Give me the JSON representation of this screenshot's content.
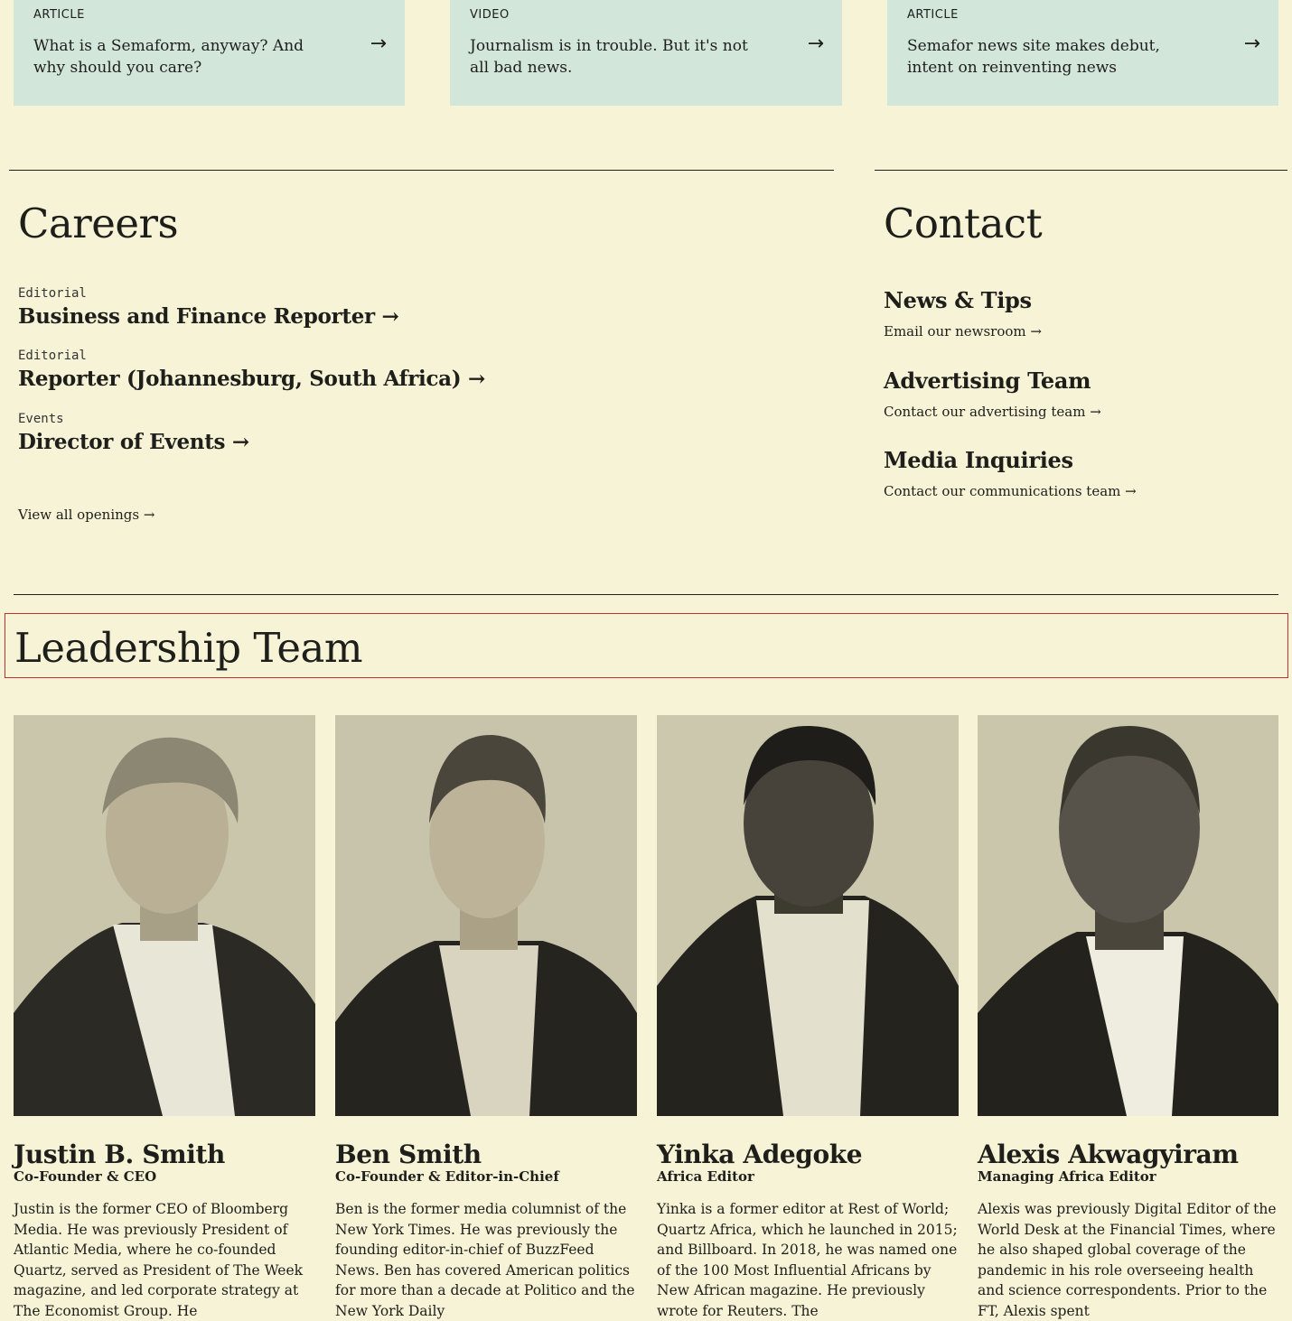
{
  "cards": [
    {
      "kind": "ARTICLE",
      "title": "What is a Semaform, anyway? And why should you care?",
      "arrow": "→"
    },
    {
      "kind": "VIDEO",
      "title": "Journalism is in trouble. But it's not all bad news.",
      "arrow": "→"
    },
    {
      "kind": "ARTICLE",
      "title": "Semafor news site makes debut, intent on reinventing news",
      "arrow": "→"
    }
  ],
  "careers": {
    "title": "Careers",
    "jobs": [
      {
        "category": "Editorial",
        "title": "Business and Finance Reporter →"
      },
      {
        "category": "Editorial",
        "title": "Reporter (Johannesburg, South Africa) →"
      },
      {
        "category": "Events",
        "title": "Director of Events →"
      }
    ],
    "view_all": "View all openings →"
  },
  "contact": {
    "title": "Contact",
    "items": [
      {
        "heading": "News & Tips",
        "link": "Email our newsroom →"
      },
      {
        "heading": "Advertising Team",
        "link": "Contact our advertising team →"
      },
      {
        "heading": "Media Inquiries",
        "link": "Contact our communications team →"
      }
    ]
  },
  "leadership": {
    "title": "Leadership Team",
    "people": [
      {
        "name": "Justin B. Smith",
        "role": "Co-Founder & CEO",
        "bio": "Justin is the former CEO of Bloomberg Media. He was previously President of Atlantic Media, where he co-founded Quartz, served as President of The Week magazine, and led corporate strategy at The Economist Group. He"
      },
      {
        "name": "Ben Smith",
        "role": "Co-Founder & Editor-in-Chief",
        "bio": "Ben is the former media columnist of the New York Times. He was previously the founding editor-in-chief of BuzzFeed News. Ben has covered American politics for more than a decade at Politico and the New York Daily"
      },
      {
        "name": "Yinka Adegoke",
        "role": "Africa Editor",
        "bio": "Yinka is a former editor at Rest of World; Quartz Africa, which he launched in 2015; and Billboard. In 2018, he was named one of the 100 Most Influential Africans by New African magazine. He previously wrote for Reuters. The"
      },
      {
        "name": "Alexis Akwagyiram",
        "role": "Managing Africa Editor",
        "bio": "Alexis was previously Digital Editor of the World Desk at the Financial Times, where he also shaped global coverage of the pandemic in his role overseeing health and science correspondents. Prior to the FT, Alexis spent"
      }
    ]
  }
}
